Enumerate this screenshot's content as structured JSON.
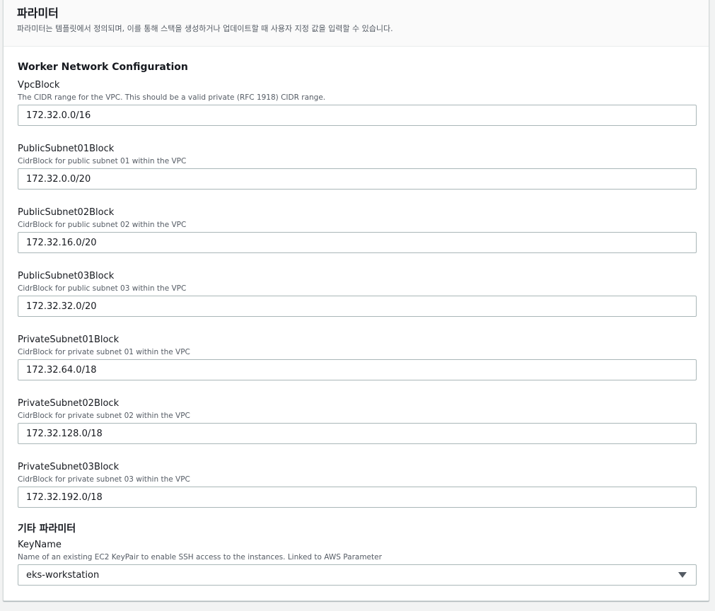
{
  "panel": {
    "title": "파라미터",
    "description": "파라미터는 템플릿에서 정의되며, 이를 통해 스택을 생성하거나 업데이트할 때 사용자 지정 값을 입력할 수 있습니다."
  },
  "network_section": {
    "title": "Worker Network Configuration",
    "fields": [
      {
        "label": "VpcBlock",
        "description": "The CIDR range for the VPC. This should be a valid private (RFC 1918) CIDR range.",
        "value": "172.32.0.0/16"
      },
      {
        "label": "PublicSubnet01Block",
        "description": "CidrBlock for public subnet 01 within the VPC",
        "value": "172.32.0.0/20"
      },
      {
        "label": "PublicSubnet02Block",
        "description": "CidrBlock for public subnet 02 within the VPC",
        "value": "172.32.16.0/20"
      },
      {
        "label": "PublicSubnet03Block",
        "description": "CidrBlock for public subnet 03 within the VPC",
        "value": "172.32.32.0/20"
      },
      {
        "label": "PrivateSubnet01Block",
        "description": "CidrBlock for private subnet 01 within the VPC",
        "value": "172.32.64.0/18"
      },
      {
        "label": "PrivateSubnet02Block",
        "description": "CidrBlock for private subnet 02 within the VPC",
        "value": "172.32.128.0/18"
      },
      {
        "label": "PrivateSubnet03Block",
        "description": "CidrBlock for private subnet 03 within the VPC",
        "value": "172.32.192.0/18"
      }
    ]
  },
  "other_section": {
    "title": "기타 파라미터",
    "keyname": {
      "label": "KeyName",
      "description": "Name of an existing EC2 KeyPair to enable SSH access to the instances. Linked to AWS Parameter",
      "value": "eks-workstation",
      "icon": "caret-down-icon"
    }
  }
}
